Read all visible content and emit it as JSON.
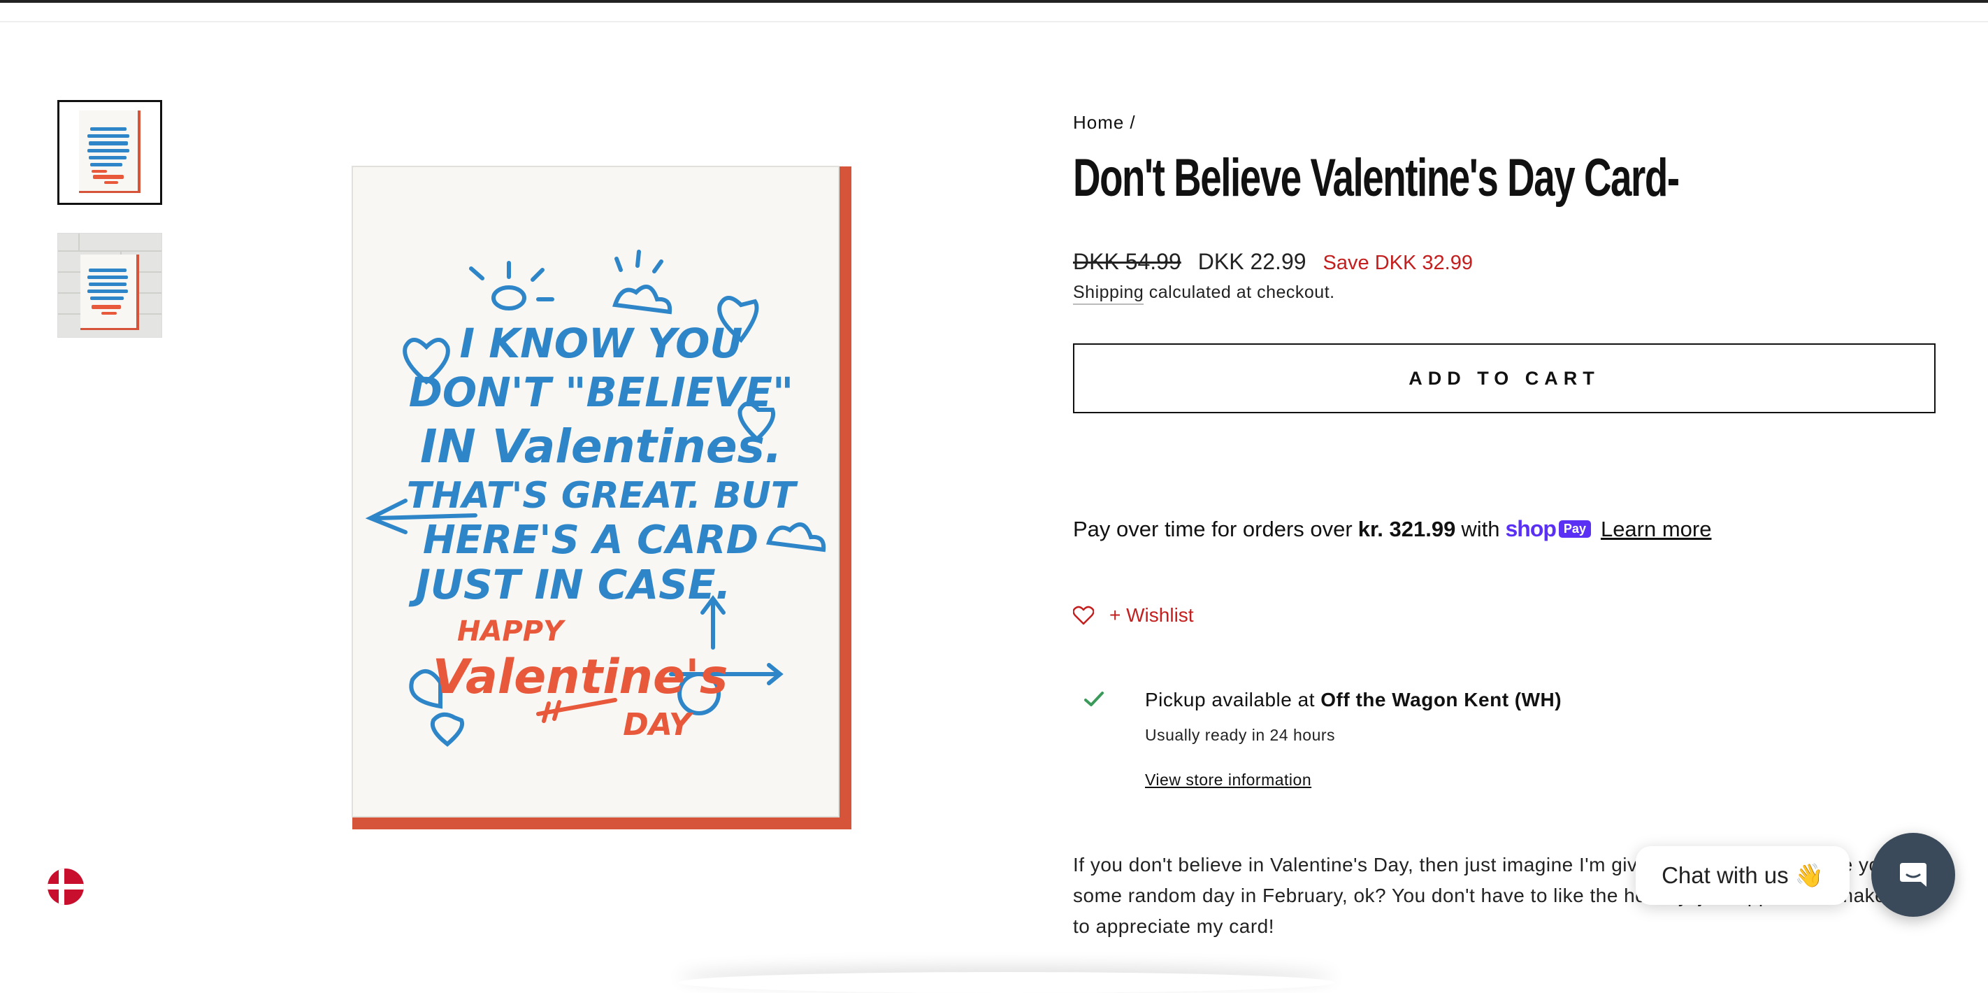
{
  "breadcrumb": {
    "home": "Home",
    "separator": "/"
  },
  "product": {
    "title": "Don't Believe Valentine's Day Card-",
    "compare_price": "DKK 54.99",
    "price": "DKK 22.99",
    "savings": "Save DKK 32.99",
    "shipping_link": "Shipping",
    "shipping_rest": " calculated at checkout.",
    "add_to_cart": "ADD TO CART",
    "description": "If you don't believe in Valentine's Day, then just imagine I'm giving you this card I wrote you on some random day in February, ok? You don't have to like the holiday, just appreciate make sure to appreciate my card!"
  },
  "card_art": {
    "lines_blue": [
      "I KNOW YOU",
      "DON'T \"BELIEVE\"",
      "IN Valentines.",
      "THAT'S GREAT. BUT",
      "HERE'S A CARD",
      "JUST IN CASE."
    ],
    "lines_red": [
      "HAPPY",
      "Valentine's",
      "DAY"
    ],
    "colors": {
      "blue": "#2e86c9",
      "red": "#e8583a",
      "border": "#d6553a",
      "paper": "#f8f7f3"
    }
  },
  "shop_pay": {
    "prefix": "Pay over time for orders over",
    "amount": "kr. 321.99",
    "with": "with",
    "brand": "shop",
    "badge": "Pay",
    "learn_more": "Learn more"
  },
  "wishlist": {
    "label": "+ Wishlist",
    "icon": "heart-outline-icon"
  },
  "pickup": {
    "prefix": "Pickup available at",
    "store": "Off the Wagon Kent (WH)",
    "ready": "Usually ready in 24 hours",
    "store_info_link": "View store information",
    "icon": "check-icon"
  },
  "chat": {
    "bubble": "Chat with us 👋",
    "icon": "chat-icon"
  },
  "locale": {
    "icon": "denmark-flag-icon"
  },
  "colors": {
    "accent_red": "#c41f1f",
    "shop_purple": "#5a31f4",
    "chat_button": "#3b4a5a",
    "check_green": "#3a9a5a"
  }
}
